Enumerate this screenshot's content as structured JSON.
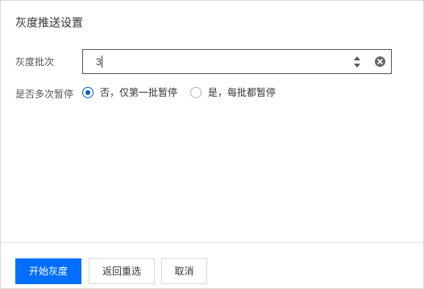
{
  "dialog": {
    "title": "灰度推送设置"
  },
  "form": {
    "batch": {
      "label": "灰度批次",
      "value": "3"
    },
    "pause": {
      "label": "是否多次暂停",
      "options": [
        {
          "label": "否，仅第一批暂停",
          "checked": true
        },
        {
          "label": "是，每批都暂停",
          "checked": false
        }
      ]
    }
  },
  "footer": {
    "start_label": "开始灰度",
    "back_label": "返回重选",
    "cancel_label": "取消"
  },
  "colors": {
    "primary": "#006eff",
    "radio_checked": "#0060c0",
    "input_border": "#555555",
    "text": "#333333"
  },
  "icons": {
    "spinner": "spinner-arrows-icon",
    "clear": "clear-circle-icon"
  }
}
